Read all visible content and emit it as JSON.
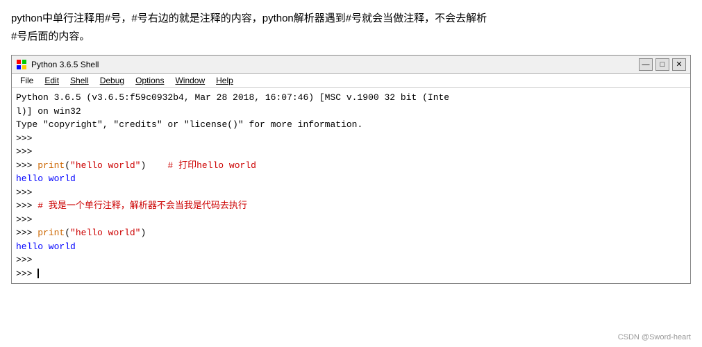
{
  "top_text": {
    "line1": "python中单行注释用#号，#号右边的就是注释的内容，python解析器遇到#号就会当做注释，不会去解析",
    "line2": "#号后面的内容。"
  },
  "window": {
    "title": "Python 3.6.5 Shell",
    "controls": {
      "minimize": "—",
      "maximize": "□",
      "close": "✕"
    },
    "menu": [
      "File",
      "Edit",
      "Shell",
      "Debug",
      "Options",
      "Window",
      "Help"
    ]
  },
  "shell": {
    "version_line1": "Python 3.6.5 (v3.6.5:f59c0932b4, Mar 28 2018, 16:07:46) [MSC v.1900 32 bit (Inte",
    "version_line2": "l)] on win32",
    "info_line": "Type \"copyright\", \"credits\" or \"license()\" for more information.",
    "lines": [
      {
        "type": "prompt",
        "text": ">>>"
      },
      {
        "type": "prompt",
        "text": ">>>"
      },
      {
        "type": "code",
        "prompt": ">>> ",
        "code": "print(\"hello world\")",
        "comment": "  # 打印hello world"
      },
      {
        "type": "output",
        "text": "hello world"
      },
      {
        "type": "prompt",
        "text": ">>>"
      },
      {
        "type": "comment",
        "prompt": ">>> ",
        "text": "# 我是一个单行注释，解析器不会当我是代码去执行"
      },
      {
        "type": "prompt",
        "text": ">>>"
      },
      {
        "type": "code2",
        "prompt": ">>> ",
        "code": "print(\"hello world\")"
      },
      {
        "type": "output",
        "text": "hello world"
      },
      {
        "type": "prompt",
        "text": ">>>"
      },
      {
        "type": "cursor_line",
        "prompt": ">>> "
      }
    ]
  },
  "watermark": "CSDN @Sword-heart"
}
